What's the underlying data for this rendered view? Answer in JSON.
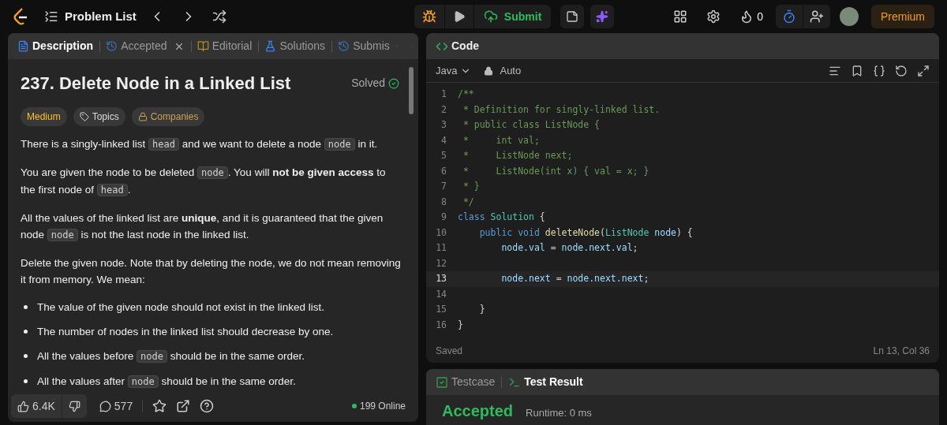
{
  "topbar": {
    "title": "Problem List",
    "submit": "Submit",
    "streak": "0",
    "premium": "Premium"
  },
  "left_tabs": [
    {
      "label": "Description",
      "selected": true,
      "closable": false
    },
    {
      "label": "Accepted",
      "selected": false,
      "closable": true
    },
    {
      "label": "Editorial",
      "selected": false,
      "closable": false
    },
    {
      "label": "Solutions",
      "selected": false,
      "closable": false
    },
    {
      "label": "Submis",
      "selected": false,
      "closable": false
    }
  ],
  "problem": {
    "title": "237. Delete Node in a Linked List",
    "status": "Solved",
    "difficulty": "Medium",
    "tags": [
      {
        "label": "Topics",
        "kind": "tag"
      },
      {
        "label": "Companies",
        "kind": "lock"
      }
    ],
    "paragraphs": [
      [
        {
          "kind": "text",
          "text": "There is a singly-linked list "
        },
        {
          "kind": "code",
          "text": "head"
        },
        {
          "kind": "text",
          "text": " and we want to delete a node "
        },
        {
          "kind": "code",
          "text": "node"
        },
        {
          "kind": "text",
          "text": " in it."
        }
      ],
      [
        {
          "kind": "text",
          "text": "You are given the node to be deleted "
        },
        {
          "kind": "code",
          "text": "node"
        },
        {
          "kind": "text",
          "text": ". You will "
        },
        {
          "kind": "bold",
          "text": "not be given access"
        },
        {
          "kind": "text",
          "text": " to the first node of "
        },
        {
          "kind": "code",
          "text": "head"
        },
        {
          "kind": "text",
          "text": "."
        }
      ],
      [
        {
          "kind": "text",
          "text": "All the values of the linked list are "
        },
        {
          "kind": "bold",
          "text": "unique"
        },
        {
          "kind": "text",
          "text": ", and it is guaranteed that the given node "
        },
        {
          "kind": "code",
          "text": "node"
        },
        {
          "kind": "text",
          "text": " is not the last node in the linked list."
        }
      ],
      [
        {
          "kind": "text",
          "text": "Delete the given node. Note that by deleting the node, we do not mean removing it from memory. We mean:"
        }
      ]
    ],
    "bullets": [
      [
        {
          "kind": "text",
          "text": "The value of the given node should not exist in the linked list."
        }
      ],
      [
        {
          "kind": "text",
          "text": "The number of nodes in the linked list should decrease by one."
        }
      ],
      [
        {
          "kind": "text",
          "text": "All the values before "
        },
        {
          "kind": "code",
          "text": "node"
        },
        {
          "kind": "text",
          "text": " should be in the same order."
        }
      ],
      [
        {
          "kind": "text",
          "text": "All the values after "
        },
        {
          "kind": "code",
          "text": "node"
        },
        {
          "kind": "text",
          "text": " should be in the same order."
        }
      ]
    ]
  },
  "footer": {
    "likes": "6.4K",
    "comments": "577",
    "online": "199 Online"
  },
  "editor": {
    "title": "Code",
    "language": "Java",
    "mode": "Auto",
    "status": "Saved",
    "cursor": "Ln 13, Col 36",
    "lines": [
      {
        "number": "1",
        "current": false,
        "tokens": [
          {
            "kind": "comment",
            "text": "/**"
          }
        ]
      },
      {
        "number": "2",
        "current": false,
        "tokens": [
          {
            "kind": "comment",
            "text": " * Definition for singly-linked list."
          }
        ]
      },
      {
        "number": "3",
        "current": false,
        "tokens": [
          {
            "kind": "comment",
            "text": " * public class ListNode {"
          }
        ]
      },
      {
        "number": "4",
        "current": false,
        "tokens": [
          {
            "kind": "comment",
            "text": " *     int val;"
          }
        ]
      },
      {
        "number": "5",
        "current": false,
        "tokens": [
          {
            "kind": "comment",
            "text": " *     ListNode next;"
          }
        ]
      },
      {
        "number": "6",
        "current": false,
        "tokens": [
          {
            "kind": "comment",
            "text": " *     ListNode(int x) { val = x; }"
          }
        ]
      },
      {
        "number": "7",
        "current": false,
        "tokens": [
          {
            "kind": "comment",
            "text": " * }"
          }
        ]
      },
      {
        "number": "8",
        "current": false,
        "tokens": [
          {
            "kind": "comment",
            "text": " */"
          }
        ]
      },
      {
        "number": "9",
        "current": false,
        "tokens": [
          {
            "kind": "keyword",
            "text": "class "
          },
          {
            "kind": "type",
            "text": "Solution"
          },
          {
            "kind": "plain",
            "text": " {"
          }
        ]
      },
      {
        "number": "10",
        "current": false,
        "tokens": [
          {
            "kind": "keyword",
            "text": "    public void "
          },
          {
            "kind": "method",
            "text": "deleteNode"
          },
          {
            "kind": "plain",
            "text": "("
          },
          {
            "kind": "type",
            "text": "ListNode"
          },
          {
            "kind": "var",
            "text": " node"
          },
          {
            "kind": "plain",
            "text": ") {"
          }
        ]
      },
      {
        "number": "11",
        "current": false,
        "tokens": [
          {
            "kind": "var",
            "text": "        node.val"
          },
          {
            "kind": "plain",
            "text": " = "
          },
          {
            "kind": "var",
            "text": "node.next.val"
          },
          {
            "kind": "plain",
            "text": ";"
          }
        ]
      },
      {
        "number": "12",
        "current": false
      },
      {
        "number": "13",
        "current": true,
        "tokens": [
          {
            "kind": "var",
            "text": "        node.next"
          },
          {
            "kind": "plain",
            "text": " = "
          },
          {
            "kind": "var",
            "text": "node.next.next"
          },
          {
            "kind": "plain",
            "text": ";"
          }
        ]
      },
      {
        "number": "14",
        "current": false
      },
      {
        "number": "15",
        "current": false,
        "tokens": [
          {
            "kind": "plain",
            "text": "    }"
          }
        ]
      },
      {
        "number": "16",
        "current": false,
        "tokens": [
          {
            "kind": "plain",
            "text": "}"
          }
        ]
      }
    ]
  },
  "bottom_tabs": [
    {
      "label": "Testcase",
      "selected": false
    },
    {
      "label": "Test Result",
      "selected": true
    }
  ],
  "result": {
    "verdict": "Accepted",
    "runtime": "Runtime: 0 ms"
  }
}
